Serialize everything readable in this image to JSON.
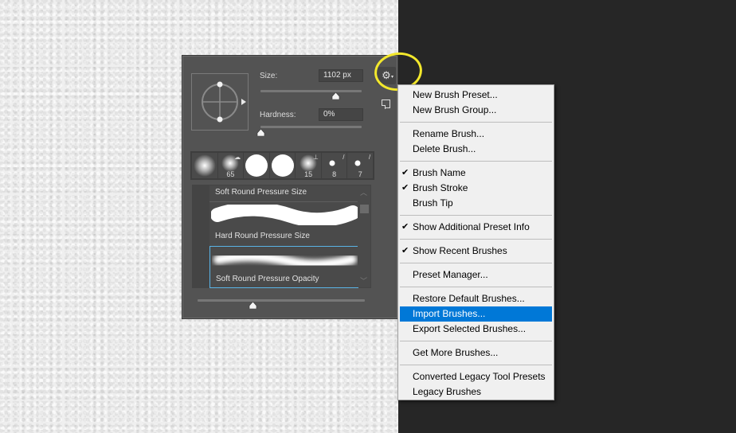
{
  "panel": {
    "size_label": "Size:",
    "size_value": "1102 px",
    "size_slider_fraction": 0.74,
    "hardness_label": "Hardness:",
    "hardness_value": "0%",
    "hardness_slider_fraction": 0.0,
    "gear_icon": "gear-icon",
    "gear_caret": "▾",
    "preview_zoom_fraction": 0.33,
    "recent_brushes": [
      {
        "size": "",
        "type": "soft-round",
        "badge": ""
      },
      {
        "size": "65",
        "type": "soft-round",
        "badge": "☁"
      },
      {
        "size": "",
        "type": "hard-round",
        "badge": ""
      },
      {
        "size": "",
        "type": "hard-round",
        "badge": ""
      },
      {
        "size": "15",
        "type": "soft-round",
        "badge": "⊥"
      },
      {
        "size": "8",
        "type": "hard-small",
        "badge": "/"
      },
      {
        "size": "7",
        "type": "hard-small",
        "badge": "/"
      }
    ],
    "presets": [
      {
        "name": "Soft Round Pressure Size",
        "selected": false
      },
      {
        "name": "Hard Round Pressure Size",
        "selected": false
      },
      {
        "name": "Soft Round Pressure Opacity",
        "selected": true
      }
    ],
    "scroll_up": "︿",
    "scroll_down": "﹀"
  },
  "menu": {
    "groups": [
      [
        {
          "label": "New Brush Preset...",
          "checked": false
        },
        {
          "label": "New Brush Group...",
          "checked": false
        }
      ],
      [
        {
          "label": "Rename Brush...",
          "checked": false
        },
        {
          "label": "Delete Brush...",
          "checked": false
        }
      ],
      [
        {
          "label": "Brush Name",
          "checked": true
        },
        {
          "label": "Brush Stroke",
          "checked": true
        },
        {
          "label": "Brush Tip",
          "checked": false
        }
      ],
      [
        {
          "label": "Show Additional Preset Info",
          "checked": true
        }
      ],
      [
        {
          "label": "Show Recent Brushes",
          "checked": true
        }
      ],
      [
        {
          "label": "Preset Manager...",
          "checked": false
        }
      ],
      [
        {
          "label": "Restore Default Brushes...",
          "checked": false
        },
        {
          "label": "Import Brushes...",
          "checked": false,
          "active": true
        },
        {
          "label": "Export Selected Brushes...",
          "checked": false
        }
      ],
      [
        {
          "label": "Get More Brushes...",
          "checked": false
        }
      ],
      [
        {
          "label": "Converted Legacy Tool Presets",
          "checked": false
        },
        {
          "label": "Legacy Brushes",
          "checked": false
        }
      ]
    ],
    "check_glyph": "✔",
    "highlight_color": "#0078d7"
  },
  "annotation": {
    "highlight_color": "#f3e82c"
  }
}
